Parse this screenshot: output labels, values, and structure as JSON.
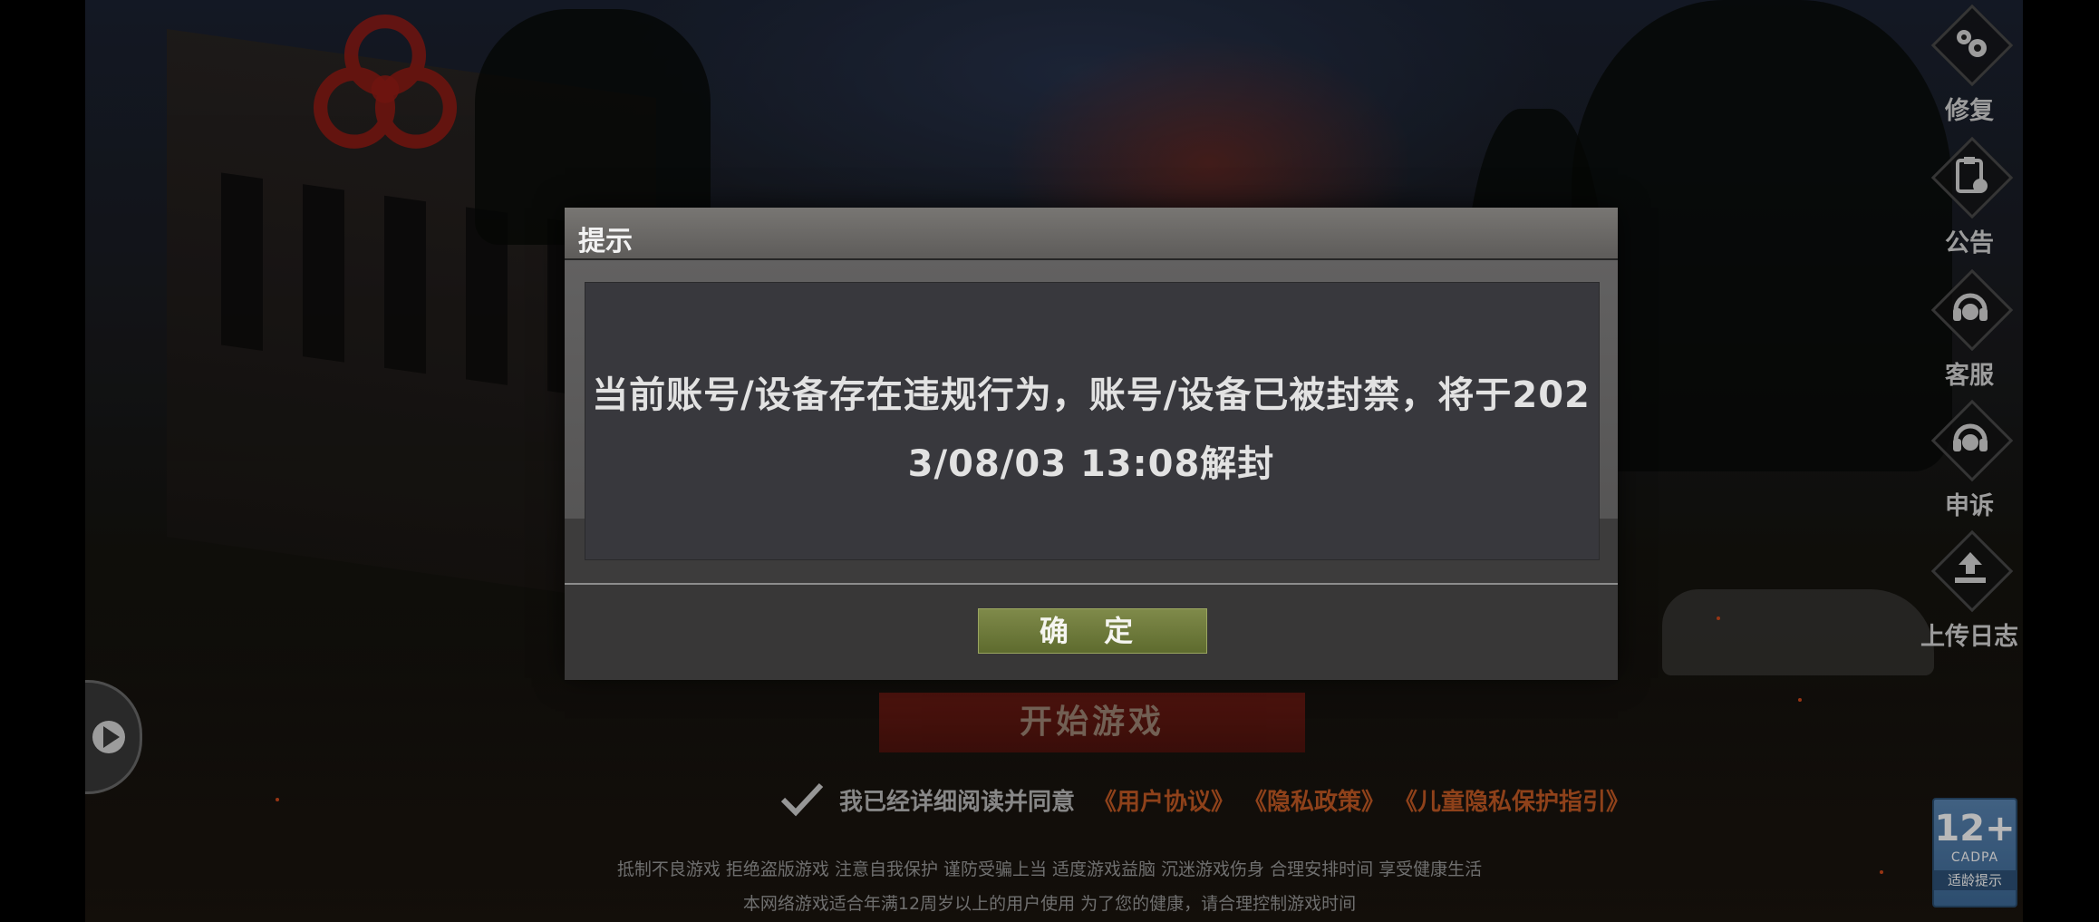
{
  "dialog": {
    "title": "提示",
    "message_line1": "当前账号/设备存在违规行为，账号/设备已被封禁，将于202",
    "message_line2": "3/08/03 13:08解封",
    "confirm_label": "确 定"
  },
  "side_menu": {
    "items": [
      {
        "label": "修复",
        "icon": "gear-icon"
      },
      {
        "label": "公告",
        "icon": "notice-clipboard-icon"
      },
      {
        "label": "客服",
        "icon": "headset-icon"
      },
      {
        "label": "申诉",
        "icon": "headset-appeal-icon"
      },
      {
        "label": "上传日志",
        "icon": "upload-icon"
      }
    ]
  },
  "start_button_label": "开始游戏",
  "agreement": {
    "text": "我已经详细阅读并同意",
    "links": [
      "《用户协议》",
      "《隐私政策》",
      "《儿童隐私保护指引》"
    ]
  },
  "health_notice_line1": "抵制不良游戏 拒绝盗版游戏 注意自我保护 谨防受骗上当 适度游戏益脑 沉迷游戏伤身 合理安排时间 享受健康生活",
  "health_notice_line2": "本网络游戏适合年满12周岁以上的用户使用    为了您的健康，请合理控制游戏时间",
  "age_badge": {
    "rating": "12+",
    "org": "CADPA",
    "tip": "适龄提示"
  },
  "colors": {
    "accent_link": "#c55a24",
    "confirm_button": "#6f7b3a",
    "start_button": "#6a1912"
  }
}
